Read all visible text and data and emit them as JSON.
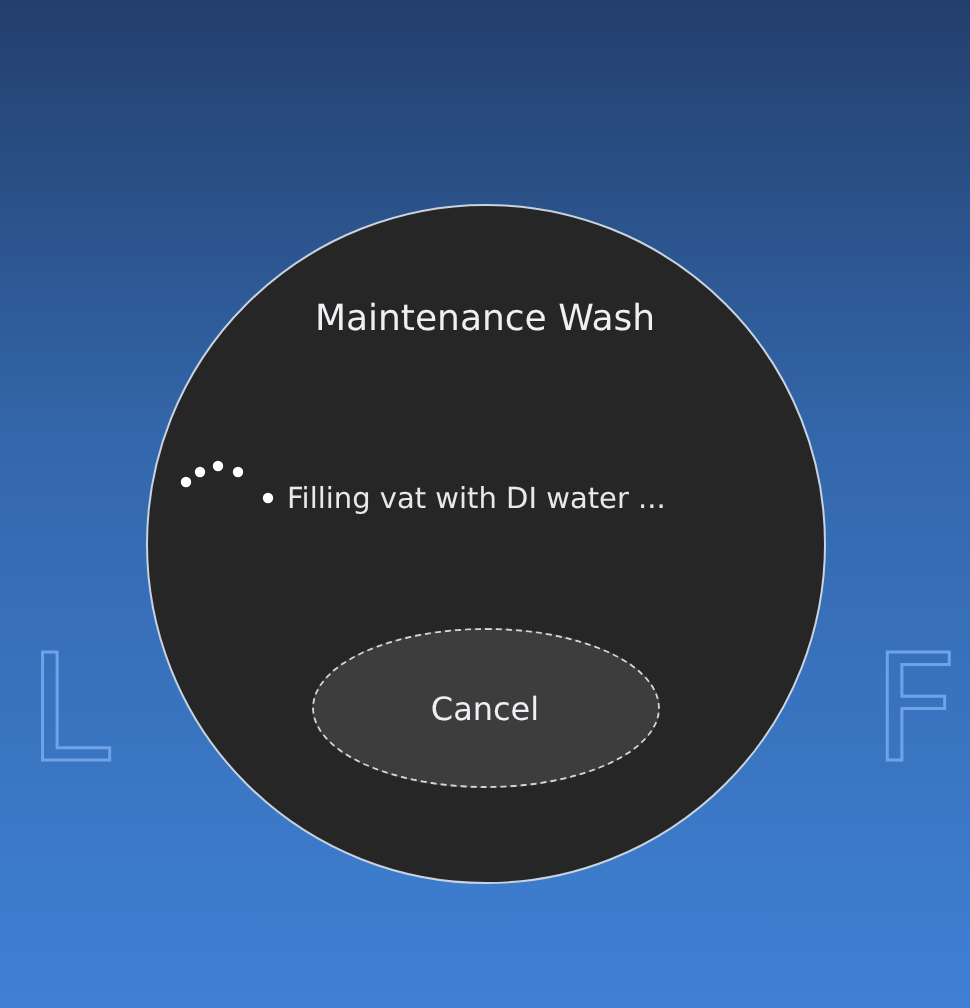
{
  "background_logo": {
    "left": "L",
    "right": "F"
  },
  "dialog": {
    "title": "Maintenance Wash",
    "status": "Filling vat with DI water ...",
    "buttons": [
      "Cancel"
    ]
  }
}
